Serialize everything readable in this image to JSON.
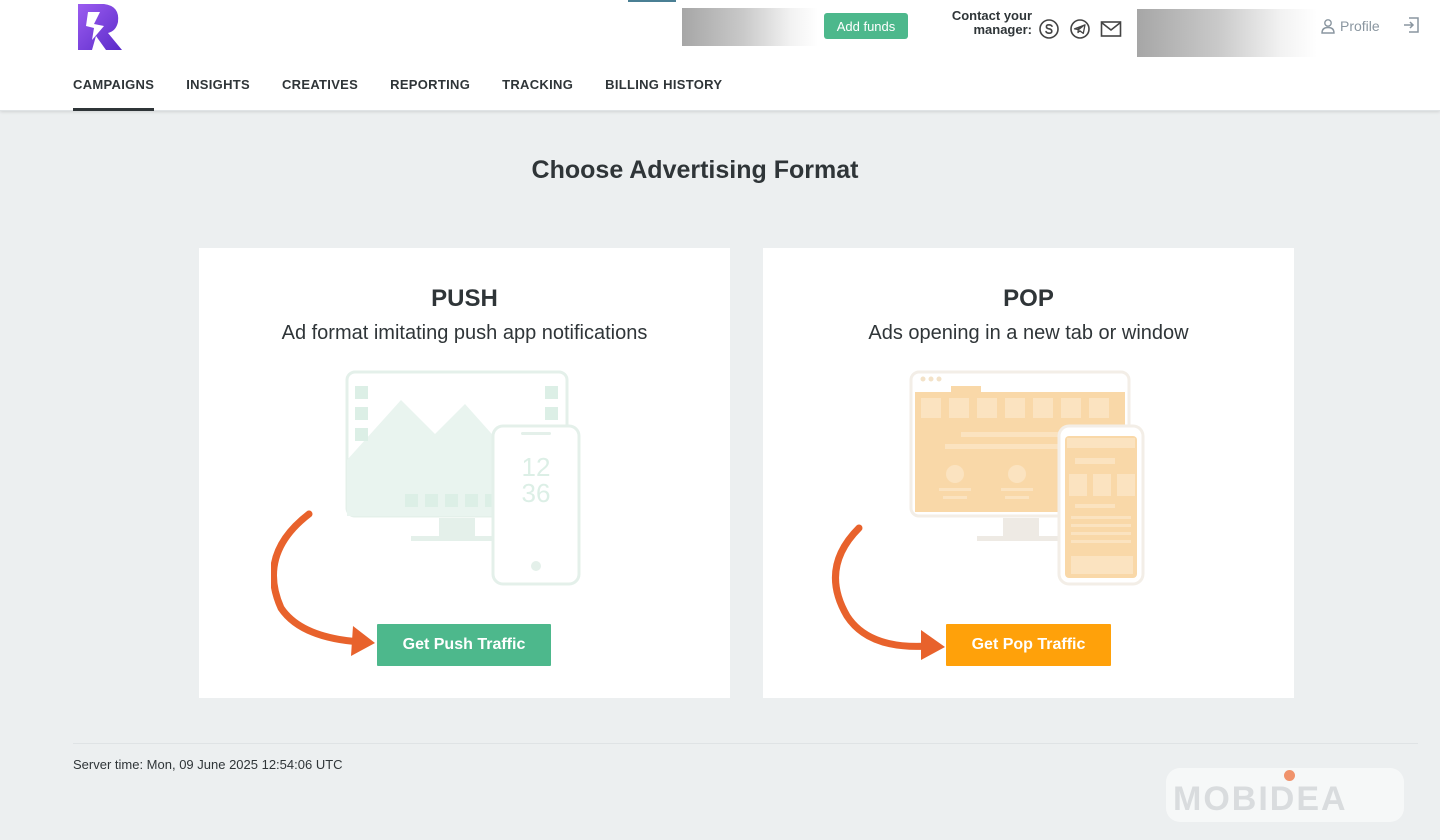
{
  "header": {
    "add_funds_label": "Add funds",
    "contact_label": "Contact your manager:",
    "contact_icons": [
      "skype-icon",
      "telegram-icon",
      "mail-icon"
    ],
    "profile_label": "Profile",
    "nav": [
      {
        "label": "CAMPAIGNS",
        "active": true
      },
      {
        "label": "INSIGHTS"
      },
      {
        "label": "CREATIVES"
      },
      {
        "label": "REPORTING"
      },
      {
        "label": "TRACKING"
      },
      {
        "label": "BILLING HISTORY"
      }
    ]
  },
  "main": {
    "title": "Choose Advertising Format",
    "cards": [
      {
        "title": "PUSH",
        "description": "Ad format imitating push app notifications",
        "button_label": "Get Push Traffic",
        "button_color": "#4db88c",
        "phone_time": [
          "12",
          "36"
        ]
      },
      {
        "title": "POP",
        "description": "Ads opening in a new tab or window",
        "button_label": "Get Pop Traffic",
        "button_color": "#ffa10a"
      }
    ]
  },
  "footer": {
    "server_time": "Server time: Mon, 09 June 2025 12:54:06 UTC",
    "brand_watermark": "MOBIDEA"
  },
  "colors": {
    "accent_green": "#4db88c",
    "accent_orange": "#ffa10a",
    "arrow_orange": "#e8622c",
    "logo_purple": "#7a3ee0"
  }
}
